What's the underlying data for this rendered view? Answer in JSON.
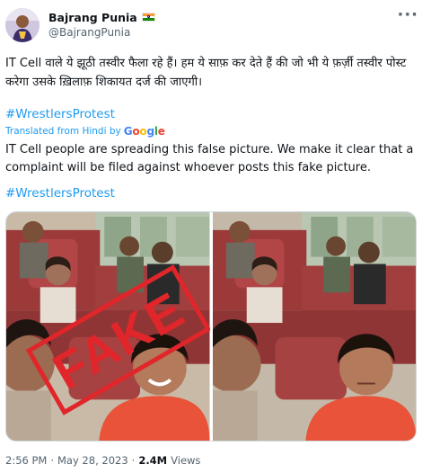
{
  "author": {
    "name": "Bajrang Punia",
    "handle": "@BajrangPunia"
  },
  "post": {
    "text_hindi": "IT Cell वाले ये झूठी तस्वीर फैला रहे हैं। हम ये साफ़ कर देते हैं की जो भी ये फ़र्ज़ी तस्वीर पोस्ट करेगा उसके ख़िलाफ़ शिकायत दर्ज की जाएगी।",
    "hashtag_hindi": "#WrestlersProtest",
    "translated_label": "Translated from Hindi by",
    "translator": "Google",
    "text_english": "IT Cell people are spreading this false picture. We make it clear that a complaint will be filed against whoever posts this fake picture.",
    "hashtag_english": "#WrestlersProtest",
    "stamp_text": "FAKE"
  },
  "meta": {
    "time": "2:56 PM",
    "date": "May 28, 2023",
    "views_count": "2.4M",
    "views_label": "Views"
  },
  "colors": {
    "link": "#1d9bf0",
    "secondary": "#536471",
    "stamp": "#e0262a"
  },
  "icons": [
    "more-options-icon",
    "india-flag-icon",
    "google-logo-icon"
  ]
}
